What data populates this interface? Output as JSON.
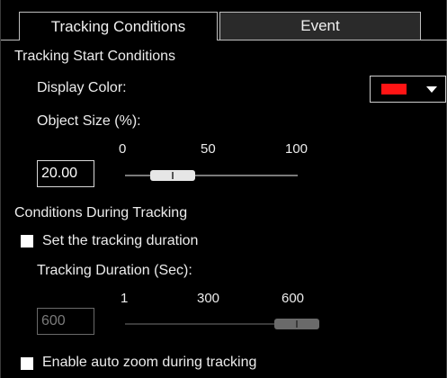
{
  "tabs": [
    {
      "label": "Tracking Conditions",
      "active": true
    },
    {
      "label": "Event",
      "active": false
    }
  ],
  "start_section": {
    "heading": "Tracking Start Conditions",
    "display_color_label": "Display Color:",
    "display_color_value": "#ff1414",
    "object_size_label": "Object Size (%):",
    "slider_ticks": [
      "0",
      "50",
      "100"
    ],
    "object_size_value": "20.00",
    "slider_fraction": 0.2
  },
  "during_section": {
    "heading": "Conditions During Tracking",
    "set_duration_label": "Set the tracking duration",
    "set_duration_checked": false,
    "duration_label": "Tracking Duration (Sec):",
    "slider_ticks": [
      "1",
      "300",
      "600"
    ],
    "duration_value": "600",
    "slider_fraction": 1.0,
    "enabled": false,
    "auto_zoom_label": "Enable auto zoom during tracking",
    "auto_zoom_checked": false
  },
  "colors": {
    "text": "#ececec",
    "slider_thumb_active": "#e6e6e6",
    "slider_thumb_disabled": "#6a6a6a"
  }
}
